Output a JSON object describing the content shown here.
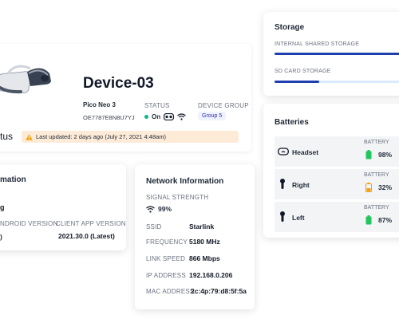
{
  "device": {
    "name": "Device-03",
    "model": "Pico Neo 3",
    "serial": "OE7787E8N8U7YJ",
    "status_label": "STATUS",
    "status_value": "On",
    "group_label": "DEVICE GROUP",
    "group_value": "Group 5",
    "status_heading_partial": "tus",
    "last_updated": "Last updated: 2 days ago (July 27, 2021 4:48am)"
  },
  "information": {
    "title_partial": "mation",
    "partial_value": "g",
    "android_label_partial": "NDROID VERSION",
    "android_value_partial": ")",
    "client_label": "CLIENT APP VERSION",
    "client_value": "2021.30.0 (Latest)"
  },
  "network": {
    "title": "Network Information",
    "signal_label": "SIGNAL STRENGTH",
    "signal_value": "99%",
    "rows": [
      {
        "label": "SSID",
        "value": "Starlink"
      },
      {
        "label": "FREQUENCY",
        "value": "5180 MHz"
      },
      {
        "label": "LINK SPEED",
        "value": "866 Mbps"
      },
      {
        "label": "IP ADDRESS",
        "value": "192.168.0.206"
      },
      {
        "label": "MAC ADDRESS",
        "value": "2c:4p:79:d8:5f:5a"
      }
    ]
  },
  "storage": {
    "title": "Storage",
    "internal_label": "INTERNAL SHARED STORAGE",
    "internal_fill": 0.92,
    "sd_label": "SD CARD STORAGE",
    "sd_fill": 0.32
  },
  "batteries": {
    "title": "Batteries",
    "battery_label": "BATTERY",
    "items": [
      {
        "name": "Headset",
        "icon": "headset-icon",
        "value": "98%",
        "color": "#22c55e"
      },
      {
        "name": "Right",
        "icon": "controller-icon",
        "value": "32%",
        "color": "#f59e0b"
      },
      {
        "name": "Left",
        "icon": "controller-icon",
        "value": "87%",
        "color": "#22c55e"
      }
    ]
  },
  "colors": {
    "accent": "#1e40af",
    "status_on": "#10b981",
    "warning_bg": "#fdebd8",
    "warning_icon": "#f59e0b"
  }
}
